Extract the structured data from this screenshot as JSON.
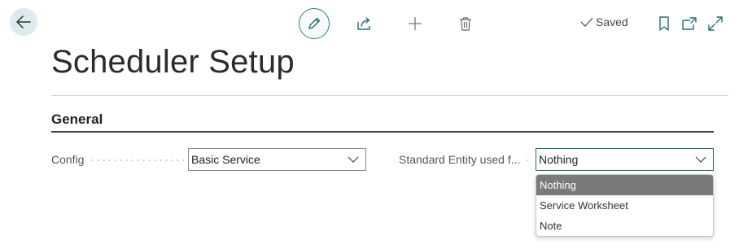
{
  "toolbar": {
    "saved_label": "Saved"
  },
  "page": {
    "title": "Scheduler Setup"
  },
  "section": {
    "title": "General"
  },
  "fields": {
    "config": {
      "label": "Config",
      "value": "Basic Service"
    },
    "standard_entity": {
      "label": "Standard Entity used f...",
      "value": "Nothing"
    }
  },
  "dropdown": {
    "options": [
      "Nothing",
      "Service Worksheet",
      "Note"
    ],
    "selected": "Nothing"
  },
  "colors": {
    "accent": "#2a7f86",
    "back_button_bg": "#dcebed",
    "selected_option_bg": "#7a7a7a"
  },
  "icons": {
    "back": "arrow-left-icon",
    "edit": "pencil-icon",
    "share": "share-icon",
    "new": "plus-icon",
    "delete": "trash-icon",
    "saved": "checkmark-icon",
    "bookmark": "bookmark-icon",
    "popout": "open-new-window-icon",
    "expand": "expand-icon",
    "dropdown": "chevron-down-icon"
  }
}
